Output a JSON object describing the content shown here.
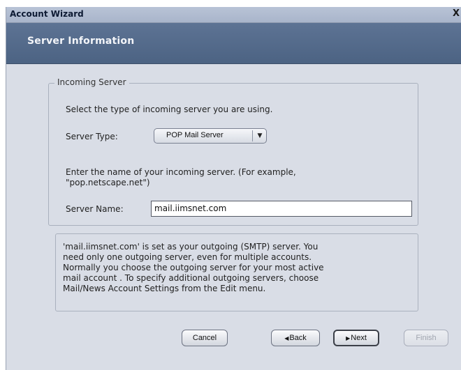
{
  "window": {
    "title": "Account Wizard",
    "close_label": "X"
  },
  "banner": {
    "heading": "Server Information"
  },
  "incoming": {
    "legend": "Incoming Server",
    "select_prompt": "Select the type of incoming server you are using.",
    "server_type_label": "Server Type:",
    "server_type_value": "POP Mail Server",
    "name_prompt_line1": "Enter the name of your incoming server. (For example,",
    "name_prompt_line2": "\"pop.netscape.net\")",
    "server_name_label": "Server Name:",
    "server_name_value": "mail.iimsnet.com"
  },
  "info": {
    "lines": [
      "'mail.iimsnet.com' is set as your outgoing (SMTP) server. You",
      "need only one outgoing server, even for multiple accounts.",
      "Normally you choose the outgoing server for your most active",
      "mail account . To specify additional outgoing servers, choose",
      "Mail/News Account Settings from the Edit menu."
    ]
  },
  "buttons": {
    "cancel": "Cancel",
    "back": "Back",
    "next": "Next",
    "finish": "Finish"
  },
  "colors": {
    "dialog_bg": "#d9dde6",
    "banner_bg": "#536a8b",
    "titlebar_bg": "#b1bcd0"
  }
}
